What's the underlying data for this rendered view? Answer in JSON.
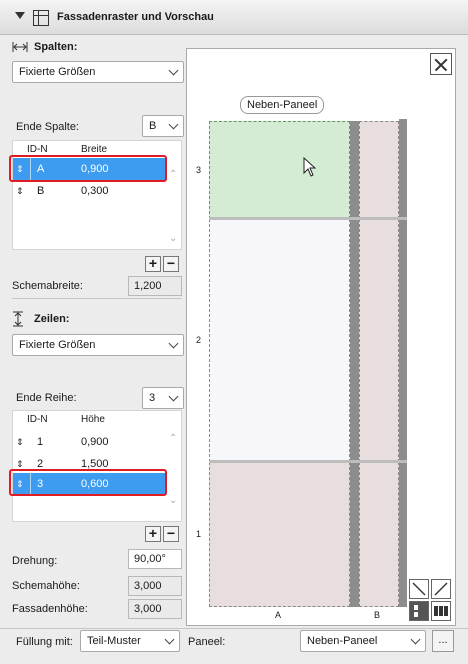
{
  "header": {
    "title": "Fassadenraster und Vorschau"
  },
  "columns": {
    "section_label": "Spalten:",
    "mode": "Fixierte Größen",
    "end_label": "Ende Spalte:",
    "end_value": "B",
    "head_id": "ID-N",
    "head_size": "Breite",
    "rows": [
      {
        "id": "A",
        "value": "0,900",
        "selected": true
      },
      {
        "id": "B",
        "value": "0,300",
        "selected": false
      }
    ],
    "schema_label": "Schemabreite:",
    "schema_value": "1,200"
  },
  "rows_section": {
    "section_label": "Zeilen:",
    "mode": "Fixierte Größen",
    "end_label": "Ende Reihe:",
    "end_value": "3",
    "head_id": "ID-N",
    "head_size": "Höhe",
    "rows": [
      {
        "id": "1",
        "value": "0,900",
        "selected": false
      },
      {
        "id": "2",
        "value": "1,500",
        "selected": false
      },
      {
        "id": "3",
        "value": "0,600",
        "selected": true
      }
    ]
  },
  "bottom_fields": {
    "rotation_label": "Drehung:",
    "rotation_value": "90,00°",
    "schema_height_label": "Schemahöhe:",
    "schema_height_value": "3,000",
    "facade_height_label": "Fassadenhöhe:",
    "facade_height_value": "3,000"
  },
  "preview": {
    "tooltip": "Neben-Paneel",
    "row_labels": [
      "3",
      "2",
      "1"
    ],
    "col_labels": [
      "A",
      "B"
    ]
  },
  "footer": {
    "fill_label": "Füllung mit:",
    "fill_value": "Teil-Muster",
    "panel_label": "Paneel:",
    "panel_value": "Neben-Paneel",
    "more_button": "..."
  }
}
